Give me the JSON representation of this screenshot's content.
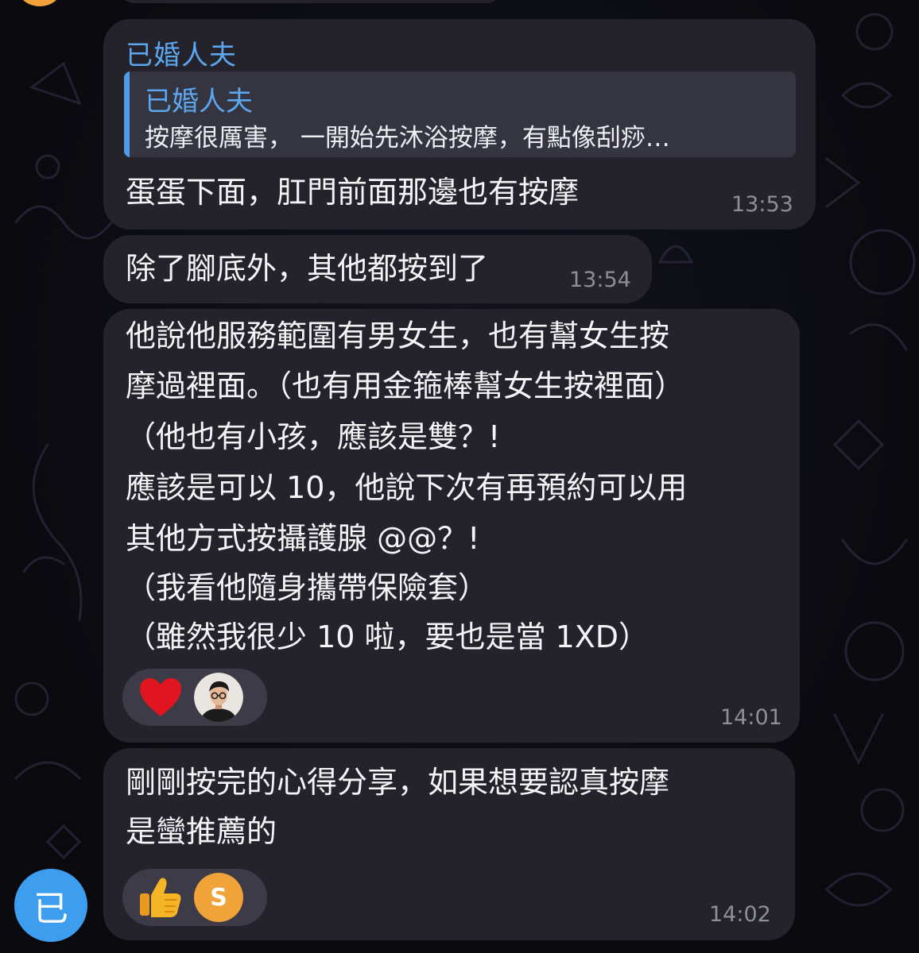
{
  "messages": [
    {
      "sender": "已婚人夫",
      "reply": {
        "author": "已婚人夫",
        "text": "按摩很厲害，  一開始先沐浴按摩，有點像刮痧…"
      },
      "text": "蛋蛋下面，肛門前面那邊也有按摩",
      "time": "13:53"
    },
    {
      "text": "除了腳底外，其他都按到了",
      "time": "13:54"
    },
    {
      "lines": [
        "他說他服務範圍有男女生，也有幫女生按",
        "摩過裡面。（也有用金箍棒幫女生按裡面）",
        "（他也有小孩，應該是雙？!",
        "應該是可以 10，他說下次有再預約可以用",
        "其他方式按攝護腺 @@？!",
        "（我看他隨身攜帶保險套）",
        "（雖然我很少 10 啦，要也是當 1XD）"
      ],
      "reactions": [
        "heart-emoji",
        "user-avatar-glasses"
      ],
      "time": "14:01"
    },
    {
      "lines": [
        "剛剛按完的心得分享，如果想要認真按摩",
        "是蠻推薦的"
      ],
      "reactions": [
        "thumbs-up-emoji",
        "user-avatar-s"
      ],
      "reaction_avatar_letter": "S",
      "time": "14:02"
    }
  ],
  "sender_avatar_letter": "已",
  "colors": {
    "background": "#0b0b10",
    "bubble": "#24222b",
    "sender_name": "#5ca6ee",
    "quote_bar": "#4f9be8",
    "timestamp": "#8e8e99",
    "avatar": "#3d9ef0",
    "heart": "#e0151f"
  }
}
